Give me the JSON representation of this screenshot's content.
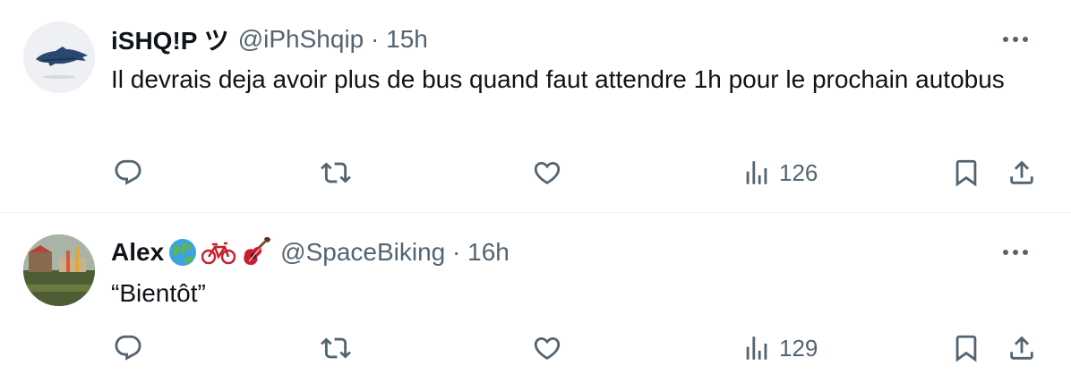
{
  "tweets": [
    {
      "display_name": "iSHQ!P ツ",
      "handle": "@iPhShqip",
      "time": "15h",
      "text": "Il devrais deja avoir plus de bus quand faut attendre 1h pour le prochain autobus",
      "views": "126",
      "avatar": "avatar-dark-blue-bird-shape"
    },
    {
      "display_name": "Alex",
      "display_name_emojis": [
        "globe-icon",
        "bicycle-icon",
        "guitar-icon"
      ],
      "handle": "@SpaceBiking",
      "time": "16h",
      "text": "“Bientôt”",
      "views": "129",
      "avatar": "avatar-photo-green-landscape"
    }
  ],
  "separator": "·",
  "icons": [
    "reply-icon",
    "retweet-icon",
    "like-icon",
    "views-icon",
    "bookmark-icon",
    "share-icon",
    "more-icon"
  ],
  "colors": {
    "text": "#0f1419",
    "secondary": "#536471",
    "divider": "#eff3f4"
  }
}
